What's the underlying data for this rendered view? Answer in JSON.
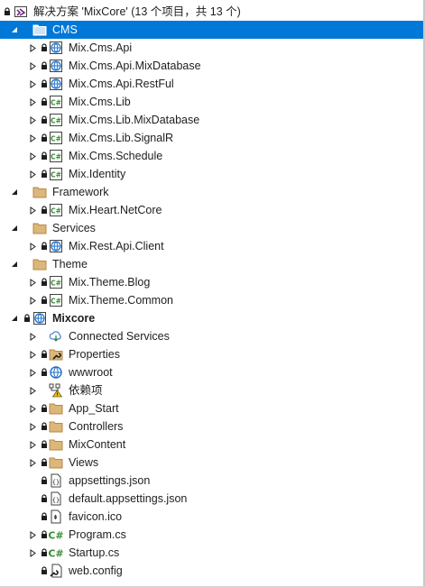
{
  "accent": "#0078d7",
  "solution": {
    "label": "解决方案 'MixCore' (13 个项目，共 13 个)",
    "icon": "solution-icon"
  },
  "folders": {
    "cms": "CMS",
    "framework": "Framework",
    "services": "Services",
    "theme": "Theme"
  },
  "cms_projects": [
    {
      "label": "Mix.Cms.Api",
      "icon": "web-project-icon"
    },
    {
      "label": "Mix.Cms.Api.MixDatabase",
      "icon": "web-project-icon"
    },
    {
      "label": "Mix.Cms.Api.RestFul",
      "icon": "web-project-icon"
    },
    {
      "label": "Mix.Cms.Lib",
      "icon": "csharp-project-icon"
    },
    {
      "label": "Mix.Cms.Lib.MixDatabase",
      "icon": "csharp-project-icon"
    },
    {
      "label": "Mix.Cms.Lib.SignalR",
      "icon": "csharp-project-icon"
    },
    {
      "label": "Mix.Cms.Schedule",
      "icon": "csharp-project-icon"
    },
    {
      "label": "Mix.Identity",
      "icon": "csharp-project-icon"
    }
  ],
  "framework_projects": [
    {
      "label": "Mix.Heart.NetCore",
      "icon": "csharp-project-icon"
    }
  ],
  "services_projects": [
    {
      "label": "Mix.Rest.Api.Client",
      "icon": "web-project-icon"
    }
  ],
  "theme_projects": [
    {
      "label": "Mix.Theme.Blog",
      "icon": "csharp-project-icon"
    },
    {
      "label": "Mix.Theme.Common",
      "icon": "csharp-project-icon"
    }
  ],
  "mixcore": {
    "label": "Mixcore",
    "items": [
      {
        "label": "Connected Services",
        "icon": "connected-services-icon"
      },
      {
        "label": "Properties",
        "icon": "properties-icon"
      },
      {
        "label": "wwwroot",
        "icon": "globe-icon"
      },
      {
        "label": "依赖项",
        "icon": "dependencies-warning-icon"
      },
      {
        "label": "App_Start",
        "icon": "folder-icon"
      },
      {
        "label": "Controllers",
        "icon": "folder-icon"
      },
      {
        "label": "MixContent",
        "icon": "folder-icon"
      },
      {
        "label": "Views",
        "icon": "folder-icon"
      },
      {
        "label": "appsettings.json",
        "icon": "json-file-icon"
      },
      {
        "label": "default.appsettings.json",
        "icon": "json-file-icon"
      },
      {
        "label": "favicon.ico",
        "icon": "ico-file-icon"
      },
      {
        "label": "Program.cs",
        "icon": "csharp-file-icon"
      },
      {
        "label": "Startup.cs",
        "icon": "csharp-file-icon"
      },
      {
        "label": "web.config",
        "icon": "config-file-icon"
      }
    ]
  }
}
